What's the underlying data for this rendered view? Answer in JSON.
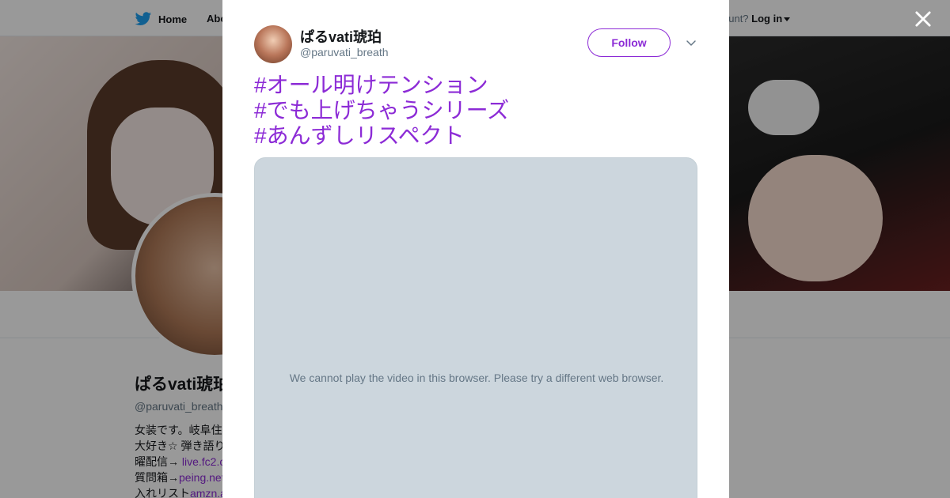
{
  "topbar": {
    "home_label": "Home",
    "about_label": "Abo",
    "login_prompt": "ccount?",
    "login_label": "Log in",
    "icons": {
      "logo": "twitter-bird-icon",
      "caret": "caret-down-icon"
    }
  },
  "background_profile": {
    "name": "ぱるvati琥珀",
    "handle": "@paruvati_breath",
    "bio_lines": [
      {
        "text": "女装です。岐阜住",
        "link": ""
      },
      {
        "text": "大好き☆ 弾き語り",
        "link": ""
      },
      {
        "text": "曜配信→ ",
        "link": "live.fc2.c"
      },
      {
        "text": "質問箱→",
        "link": "peing.net"
      },
      {
        "text": "入れリスト",
        "link": "amzn.a"
      }
    ]
  },
  "modal": {
    "close_icon": "close-icon",
    "author": {
      "name": "ぱるvati琥珀",
      "handle": "@paruvati_breath"
    },
    "follow_label": "Follow",
    "more_icon": "chevron-down-icon",
    "tweet_lines": [
      "#オール明けテンション",
      "#でも上げちゃうシリーズ",
      "#あんずしリスペクト"
    ],
    "video_message": "We cannot play the video in this browser. Please try a different web browser."
  },
  "colors": {
    "accent": "#8c2bd6",
    "banner": "#7a2fd0",
    "video_bg": "#ccd6dd",
    "text_secondary": "#657786"
  }
}
